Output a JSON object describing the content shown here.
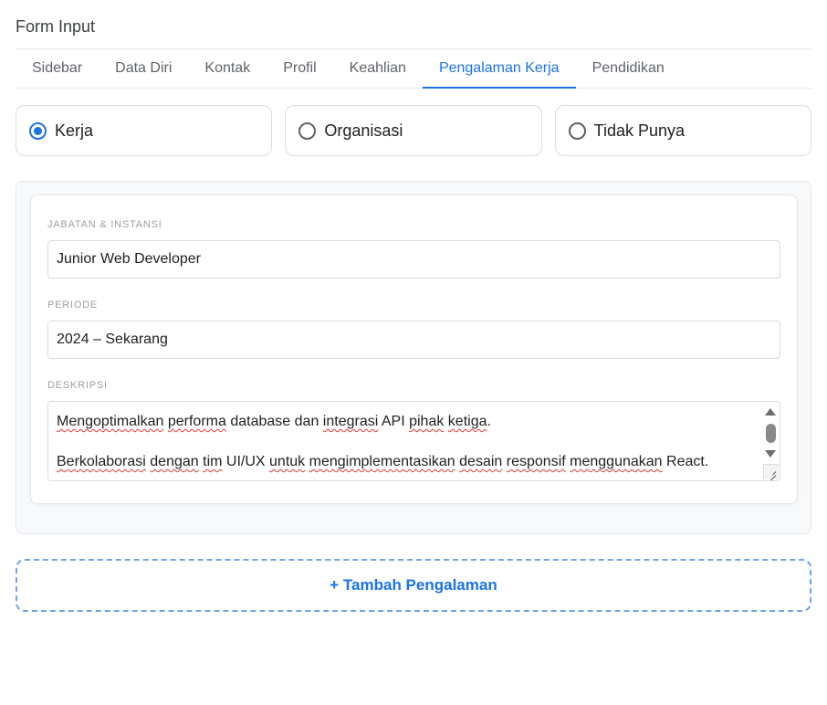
{
  "header": {
    "title": "Form Input"
  },
  "tabs": [
    {
      "label": "Sidebar"
    },
    {
      "label": "Data Diri"
    },
    {
      "label": "Kontak"
    },
    {
      "label": "Profil"
    },
    {
      "label": "Keahlian"
    },
    {
      "label": "Pengalaman Kerja"
    },
    {
      "label": "Pendidikan"
    }
  ],
  "active_tab": "Pengalaman Kerja",
  "experience_type": {
    "options": [
      {
        "label": "Kerja",
        "checked": true
      },
      {
        "label": "Organisasi",
        "checked": false
      },
      {
        "label": "Tidak Punya",
        "checked": false
      }
    ]
  },
  "experience_entry": {
    "position_label": "JABATAN & INSTANSI",
    "position_value": "Junior Web Developer",
    "period_label": "PERIODE",
    "period_value": "2024 – Sekarang",
    "description_label": "DESKRIPSI",
    "description_lines": [
      "Mengoptimalkan performa database dan integrasi API pihak ketiga.",
      "Berkolaborasi dengan tim UI/UX untuk mengimplementasikan desain responsif menggunakan React."
    ]
  },
  "add_button": {
    "label": "+ Tambah Pengalaman"
  },
  "colors": {
    "accent": "#1a73e8",
    "border": "#dadce0",
    "panel_bg": "#f7f9fb",
    "spellcheck": "#e53935"
  }
}
